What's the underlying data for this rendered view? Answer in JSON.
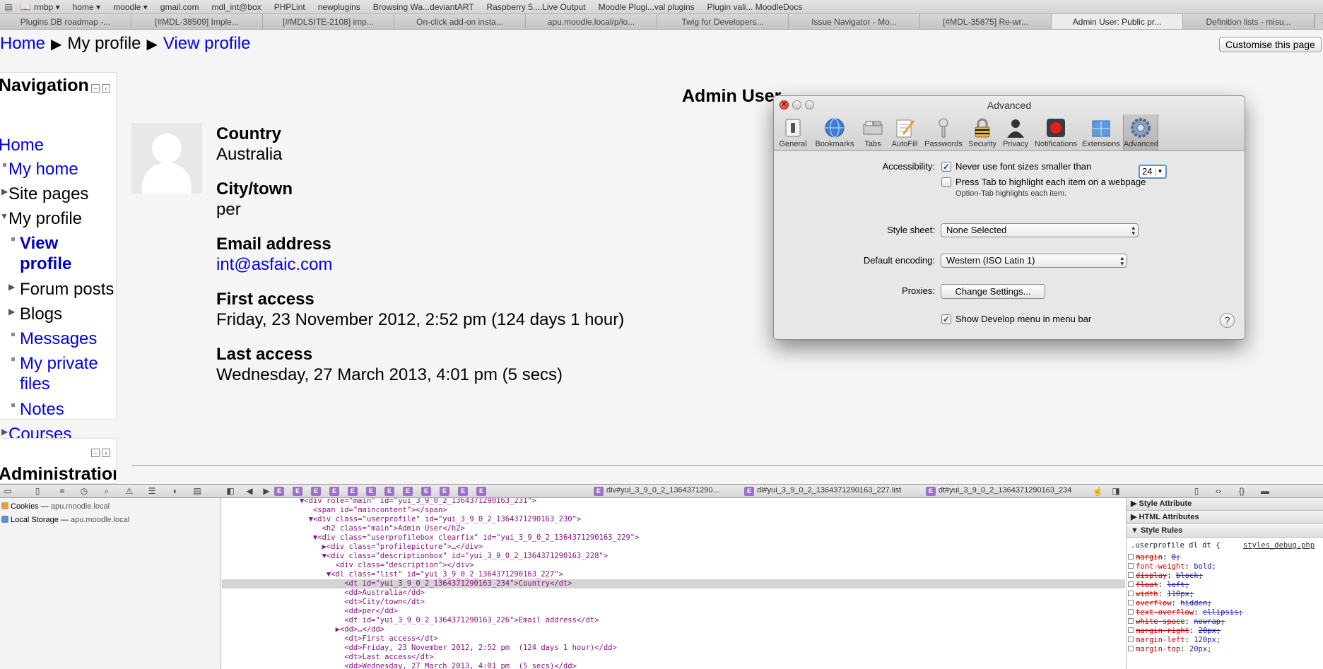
{
  "bookmarks": {
    "icons": [
      "bookmarks-menu-icon",
      "reading-list-icon"
    ],
    "items": [
      "rmbp ▾",
      "home ▾",
      "moodle ▾",
      "gmail.com",
      "mdl_int@box",
      "PHPLint",
      "newplugins",
      "Browsing Wa...deviantART",
      "Raspberry 5....Live Output",
      "Moodle Plugi...val plugins",
      "Plugin vali... MoodleDocs"
    ]
  },
  "tabs": {
    "items": [
      "Plugins DB roadmap -...",
      "[#MDL-38509] Imple...",
      "[#MDLSITE-2108] imp...",
      "On-click add-on insta...",
      "apu.moodle.local/p/lo...",
      "Twig for Developers...",
      "Issue Navigator - Mo...",
      "[#MDL-35875] Re-wr...",
      "Admin User: Public pr...",
      "Definition lists - misu..."
    ],
    "active_index": 8,
    "new_tab": "+",
    "overflow": "»"
  },
  "breadcrumb": {
    "home": "Home",
    "sep": "▶",
    "my_profile": "My profile",
    "view_profile": "View profile"
  },
  "customise_button": "Customise this page",
  "navigation": {
    "title": "Navigation",
    "items": {
      "home": "Home",
      "my_home": "My home",
      "site_pages": "Site pages",
      "my_profile": "My profile",
      "view_profile_1": "View",
      "view_profile_2": "profile",
      "forum_posts": "Forum posts",
      "blogs": "Blogs",
      "messages": "Messages",
      "private_files_1": "My private",
      "private_files_2": "files",
      "notes": "Notes",
      "courses": "Courses"
    }
  },
  "administration": {
    "title": "Administration"
  },
  "profile": {
    "name": "Admin User",
    "fields": {
      "country_label": "Country",
      "country_value": "Australia",
      "city_label": "City/town",
      "city_value": "per",
      "email_label": "Email address",
      "email_value": "int@asfaic.com",
      "first_access_label": "First access",
      "first_access_value": "Friday, 23 November 2012, 2:52 pm  (124 days 1 hour)",
      "last_access_label": "Last access",
      "last_access_value": "Wednesday, 27 March 2013, 4:01 pm  (5 secs)"
    }
  },
  "preferences": {
    "title": "Advanced",
    "tabs": [
      "General",
      "Bookmarks",
      "Tabs",
      "AutoFill",
      "Passwords",
      "Security",
      "Privacy",
      "Notifications",
      "Extensions",
      "Advanced"
    ],
    "active_tab": "Advanced",
    "accessibility_label": "Accessibility:",
    "min_font_text": "Never use font sizes smaller than",
    "min_font_checked": true,
    "min_font_value": "24",
    "press_tab_text": "Press Tab to highlight each item on a webpage",
    "press_tab_checked": false,
    "press_tab_hint": "Option-Tab highlights each item.",
    "style_sheet_label": "Style sheet:",
    "style_sheet_value": "None Selected",
    "encoding_label": "Default encoding:",
    "encoding_value": "Western (ISO Latin 1)",
    "proxies_label": "Proxies:",
    "proxies_button": "Change Settings...",
    "develop_menu_text": "Show Develop menu in menu bar",
    "develop_menu_checked": true,
    "help": "?"
  },
  "inspector": {
    "breadcrumbs": [
      "div#yui_3_9_0_2_1364371290...",
      "dl#yui_3_9_0_2_1364371290163_227.list",
      "dt#yui_3_9_0_2_1364371290163_234"
    ],
    "crumb_element_count": 12,
    "storage": [
      {
        "label": "Cookies",
        "host": "apu.moodle.local"
      },
      {
        "label": "Local Storage",
        "host": "apu.moodle.local"
      }
    ],
    "dom_lines": [
      "▼<div role=\"main\" id=\"yui_3_9_0_2_1364371290163_231\">",
      "   <span id=\"maincontent\"></span>",
      "  ▼<div class=\"userprofile\" id=\"yui_3_9_0_2_1364371290163_230\">",
      "     <h2 class=\"main\">Admin User</h2>",
      "   ▼<div class=\"userprofilebox clearfix\" id=\"yui_3_9_0_2_1364371290163_229\">",
      "     ▶<div class=\"profilepicture\">…</div>",
      "     ▼<div class=\"descriptionbox\" id=\"yui_3_9_0_2_1364371290163_228\">",
      "        <div class=\"description\"></div>",
      "      ▼<dl class=\"list\" id=\"yui_3_9_0_2_1364371290163_227\">",
      "          <dt id=\"yui_3_9_0_2_1364371290163_234\">Country</dt>",
      "          <dd>Australia</dd>",
      "          <dt>City/town</dt>",
      "          <dd>per</dd>",
      "          <dt id=\"yui_3_9_0_2_1364371290163_226\">Email address</dt>",
      "        ▶<dd>…</dd>",
      "          <dt>First access</dt>",
      "          <dd>Friday, 23 November 2012, 2:52 pm  (124 days 1 hour)</dd>",
      "          <dt>Last access</dt>",
      "          <dd>Wednesday, 27 March 2013, 4:01 pm  (5 secs)</dd>"
    ],
    "dom_indents": [
      9,
      9,
      9,
      9,
      9,
      9,
      9,
      9,
      9,
      9,
      9,
      9,
      9,
      9,
      9,
      9,
      9,
      9,
      9
    ],
    "selected_line": 9,
    "styles": {
      "sections": [
        "Style Attribute",
        "HTML Attributes",
        "Style Rules"
      ],
      "selector": ".userprofile dl dt {",
      "source": "styles_debug.php",
      "props": [
        {
          "name": "margin",
          "value": "0;",
          "struck": true
        },
        {
          "name": "font-weight",
          "value": "bold;",
          "struck": false
        },
        {
          "name": "display",
          "value": "block;",
          "struck": true
        },
        {
          "name": "float",
          "value": "left;",
          "struck": true
        },
        {
          "name": "width",
          "value": "110px;",
          "struck": true
        },
        {
          "name": "overflow",
          "value": "hidden;",
          "struck": true
        },
        {
          "name": "text-overflow",
          "value": "ellipsis;",
          "struck": true
        },
        {
          "name": "white-space",
          "value": "nowrap;",
          "struck": true
        },
        {
          "name": "margin-right",
          "value": "20px;",
          "struck": true
        },
        {
          "name": "margin-left",
          "value": "120px;",
          "struck": false
        },
        {
          "name": "margin-top",
          "value": "20px;",
          "struck": false
        }
      ]
    }
  }
}
